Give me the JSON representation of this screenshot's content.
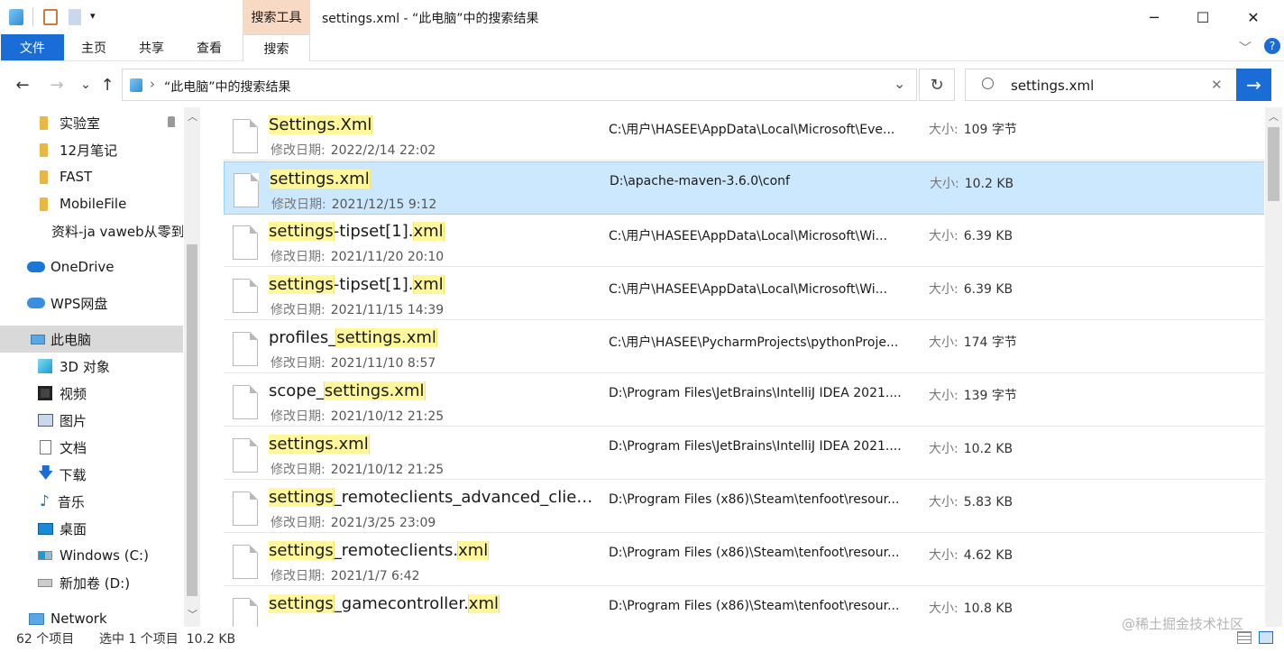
{
  "window": {
    "title": "settings.xml - “此电脑”中的搜索结果",
    "context_tab": "搜索工具",
    "minimize": "─",
    "maximize": "☐",
    "close": "✕"
  },
  "ribbon": {
    "tabs": [
      "文件",
      "主页",
      "共享",
      "查看",
      "搜索"
    ],
    "expand_icon": "﹀",
    "help_icon": "?"
  },
  "nav": {
    "back": "←",
    "forward": "→",
    "recent": "⌄",
    "up": "↑"
  },
  "address": {
    "breadcrumb_sep": "›",
    "location": "“此电脑”中的搜索结果",
    "dropdown": "⌄",
    "refresh": "↻"
  },
  "search": {
    "value": "settings.xml",
    "clear": "✕",
    "go": "→"
  },
  "sidebar": {
    "items": [
      {
        "label": "实验室",
        "icon": "folder-icon",
        "pinned": true
      },
      {
        "label": "12月笔记",
        "icon": "folder-icon"
      },
      {
        "label": "FAST",
        "icon": "folder-icon"
      },
      {
        "label": "MobileFile",
        "icon": "folder-icon"
      },
      {
        "label": "资料-ja vaweb从零到",
        "icon": "folder-icon"
      },
      {
        "label": "OneDrive",
        "icon": "cloud-icon"
      },
      {
        "label": "WPS网盘",
        "icon": "cloud-icon"
      },
      {
        "label": "此电脑",
        "icon": "computer-icon",
        "selected": true
      },
      {
        "label": "3D 对象",
        "icon": "cube-icon"
      },
      {
        "label": "视频",
        "icon": "video-icon"
      },
      {
        "label": "图片",
        "icon": "picture-icon"
      },
      {
        "label": "文档",
        "icon": "document-icon"
      },
      {
        "label": "下载",
        "icon": "download-icon"
      },
      {
        "label": "音乐",
        "icon": "music-icon"
      },
      {
        "label": "桌面",
        "icon": "desktop-icon"
      },
      {
        "label": "Windows (C:)",
        "icon": "drive-icon"
      },
      {
        "label": "新加卷 (D:)",
        "icon": "drive-icon"
      },
      {
        "label": "Network",
        "icon": "network-icon"
      }
    ]
  },
  "labels": {
    "date": "修改日期:",
    "size": "大小:"
  },
  "files": [
    {
      "name_parts": [
        [
          "Settings.Xml",
          true
        ]
      ],
      "date": "2022/2/14 22:02",
      "path": "C:\\用户\\HASEE\\AppData\\Local\\Microsoft\\Eve...",
      "size": "109 字节"
    },
    {
      "name_parts": [
        [
          "settings.xml",
          true
        ]
      ],
      "date": "2021/12/15 9:12",
      "path": "D:\\apache-maven-3.6.0\\conf",
      "size": "10.2 KB",
      "selected": true
    },
    {
      "name_parts": [
        [
          "settings",
          true
        ],
        [
          "-tipset[1].",
          false
        ],
        [
          "xml",
          true
        ]
      ],
      "date": "2021/11/20 20:10",
      "path": "C:\\用户\\HASEE\\AppData\\Local\\Microsoft\\Wi...",
      "size": "6.39 KB"
    },
    {
      "name_parts": [
        [
          "settings",
          true
        ],
        [
          "-tipset[1].",
          false
        ],
        [
          "xml",
          true
        ]
      ],
      "date": "2021/11/15 14:39",
      "path": "C:\\用户\\HASEE\\AppData\\Local\\Microsoft\\Wi...",
      "size": "6.39 KB"
    },
    {
      "name_parts": [
        [
          "profiles_",
          false
        ],
        [
          "settings.xml",
          true
        ]
      ],
      "date": "2021/11/10 8:57",
      "path": "C:\\用户\\HASEE\\PycharmProjects\\pythonProje...",
      "size": "174 字节"
    },
    {
      "name_parts": [
        [
          "scope_",
          false
        ],
        [
          "settings.xml",
          true
        ]
      ],
      "date": "2021/10/12 21:25",
      "path": "D:\\Program Files\\JetBrains\\IntelliJ IDEA 2021....",
      "size": "139 字节"
    },
    {
      "name_parts": [
        [
          "settings.xml",
          true
        ]
      ],
      "date": "2021/10/12 21:25",
      "path": "D:\\Program Files\\JetBrains\\IntelliJ IDEA 2021....",
      "size": "10.2 KB"
    },
    {
      "name_parts": [
        [
          "settings",
          true
        ],
        [
          "_remoteclients_advanced_client....",
          false
        ]
      ],
      "date": "2021/3/25 23:09",
      "path": "D:\\Program Files (x86)\\Steam\\tenfoot\\resour...",
      "size": "5.83 KB"
    },
    {
      "name_parts": [
        [
          "settings",
          true
        ],
        [
          "_remoteclients.",
          false
        ],
        [
          "xml",
          true
        ]
      ],
      "date": "2021/1/7 6:42",
      "path": "D:\\Program Files (x86)\\Steam\\tenfoot\\resour...",
      "size": "4.62 KB"
    },
    {
      "name_parts": [
        [
          "settings",
          true
        ],
        [
          "_gamecontroller.",
          false
        ],
        [
          "xml",
          true
        ]
      ],
      "date": "",
      "path": "D:\\Program Files (x86)\\Steam\\tenfoot\\resour...",
      "size": "10.8 KB"
    }
  ],
  "status": {
    "count": "62 个项目",
    "selection": "选中 1 个项目  10.2 KB"
  },
  "watermark": "@稀土掘金技术社区",
  "colors": {
    "accent": "#1a6dd6",
    "highlight": "#fff799",
    "selection": "#cce8ff",
    "context_tab": "#f8d9c4"
  }
}
